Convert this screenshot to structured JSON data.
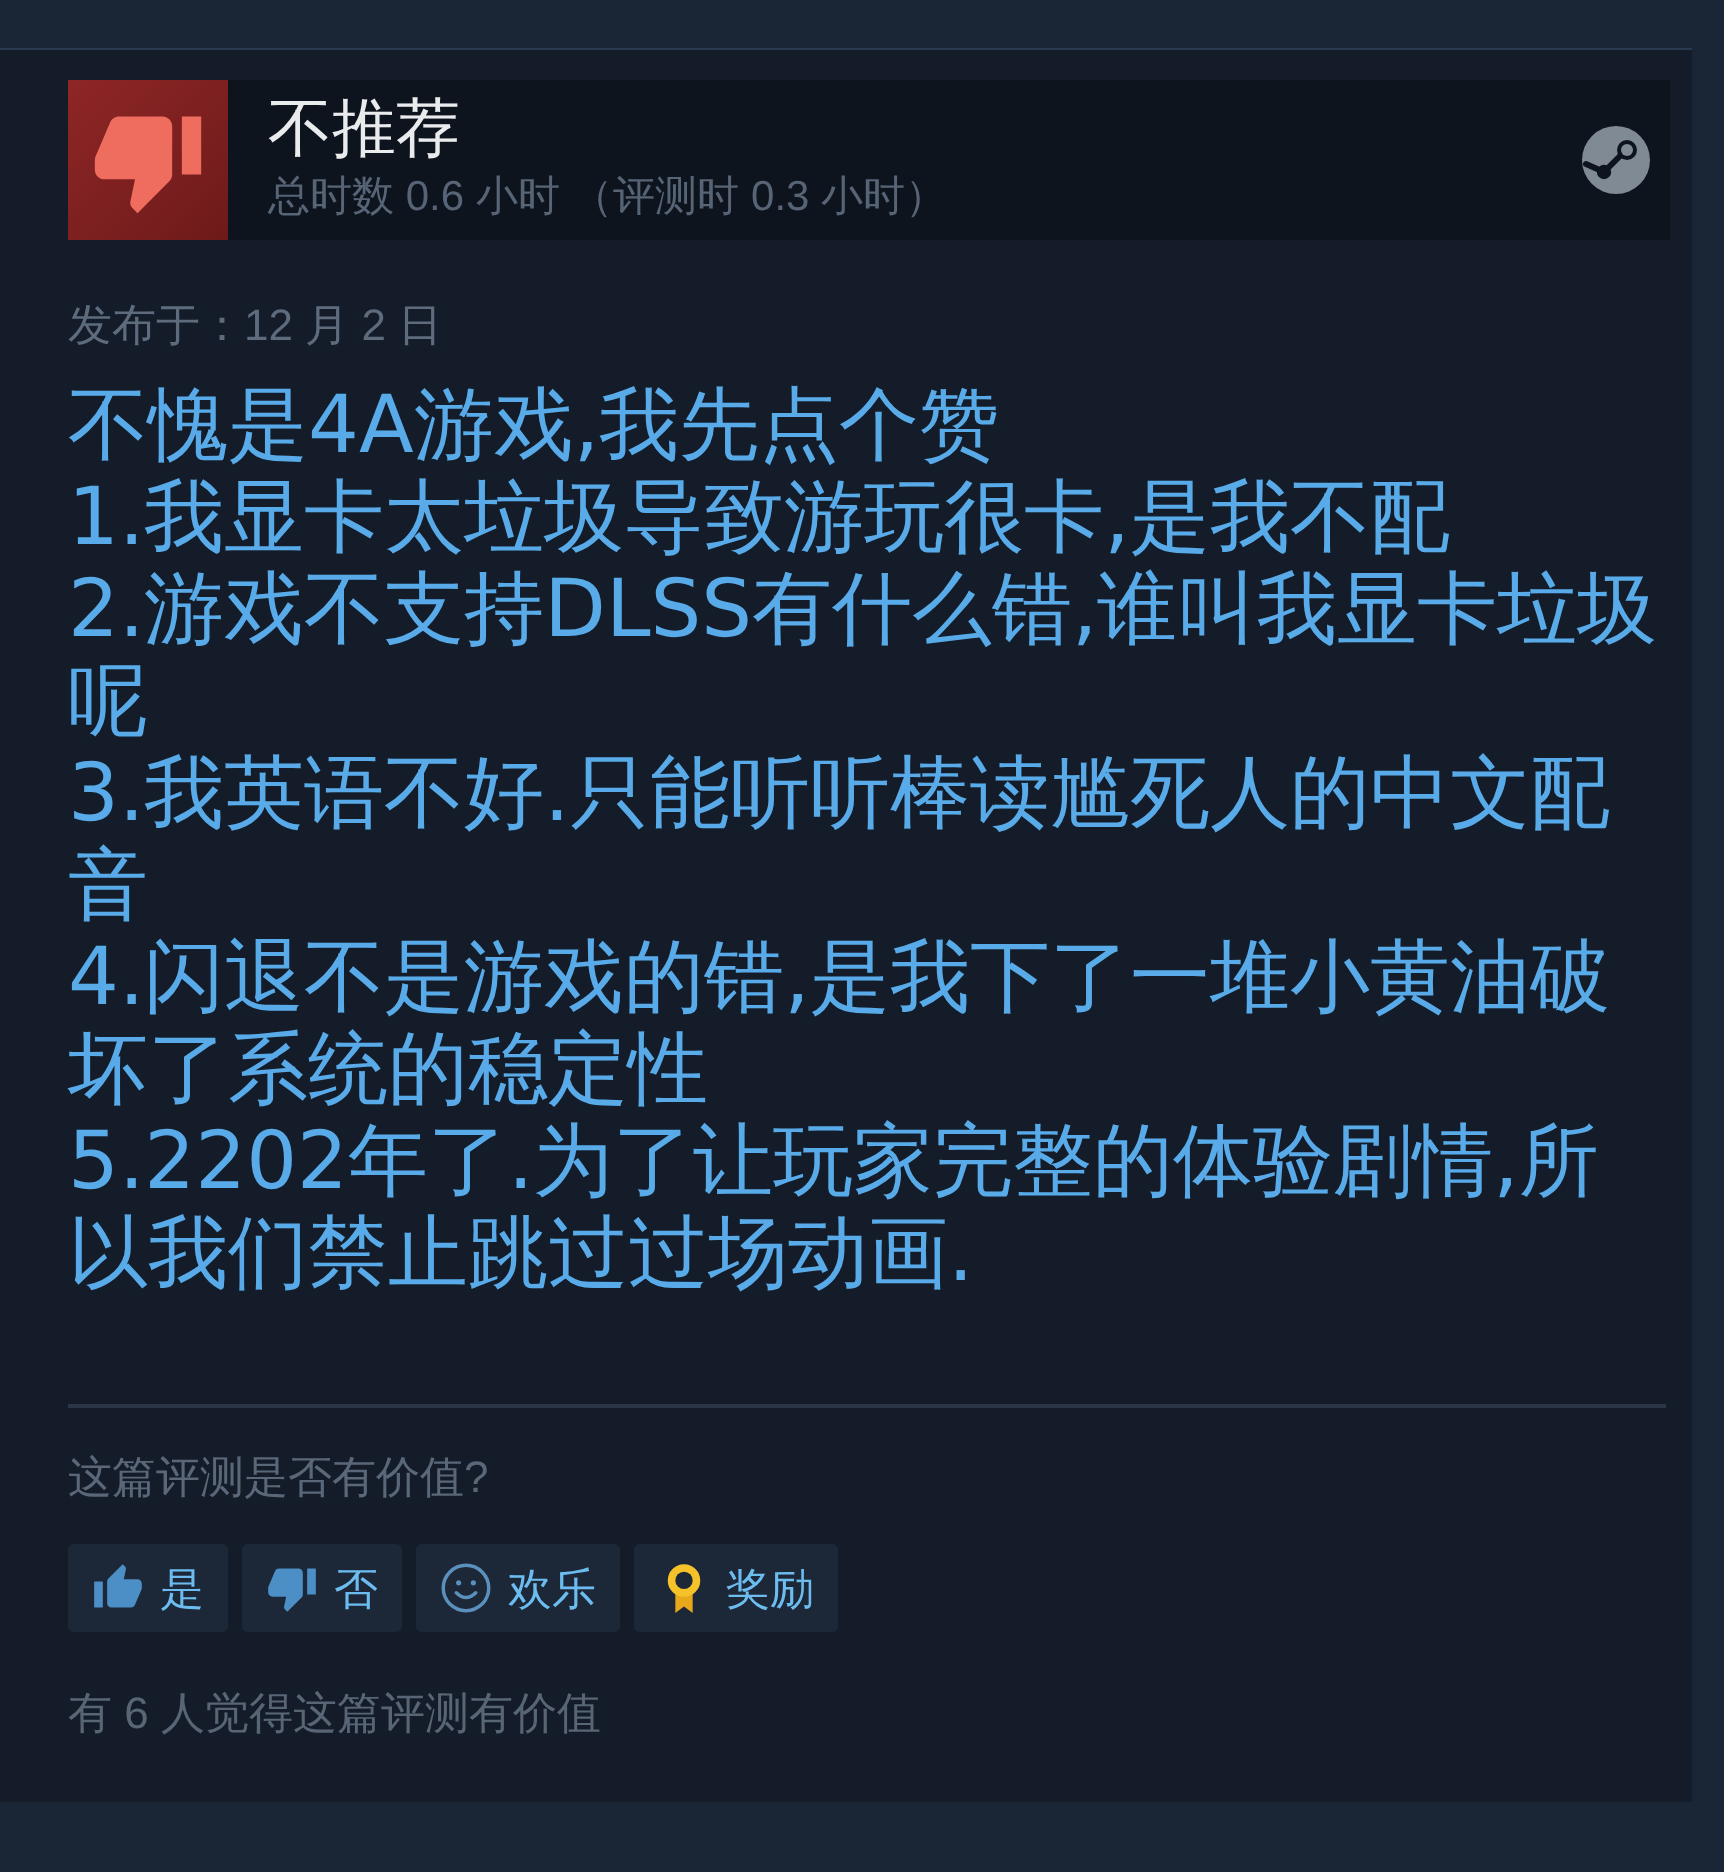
{
  "review": {
    "recommended": false,
    "verdict": "不推荐",
    "hours": "总时数 0.6 小时 （评测时 0.3 小时）",
    "posted": "发布于：12 月 2 日",
    "text": "不愧是4A游戏,我先点个赞\n1.我显卡太垃圾导致游玩很卡,是我不配\n2.游戏不支持DLSS有什么错,谁叫我显卡垃圾呢\n3.我英语不好.只能听听棒读尴死人的中文配音\n4.闪退不是游戏的错,是我下了一堆小黄油破坏了系统的稳定性\n5.2202年了.为了让玩家完整的体验剧情,所以我们禁止跳过过场动画."
  },
  "helpful": {
    "question": "这篇评测是否有价值?",
    "buttons": [
      {
        "kind": "yes",
        "label": "是"
      },
      {
        "kind": "no",
        "label": "否"
      },
      {
        "kind": "funny",
        "label": "欢乐"
      },
      {
        "kind": "award",
        "label": "奖励"
      }
    ],
    "summary": "有 6 人觉得这篇评测有价值"
  }
}
